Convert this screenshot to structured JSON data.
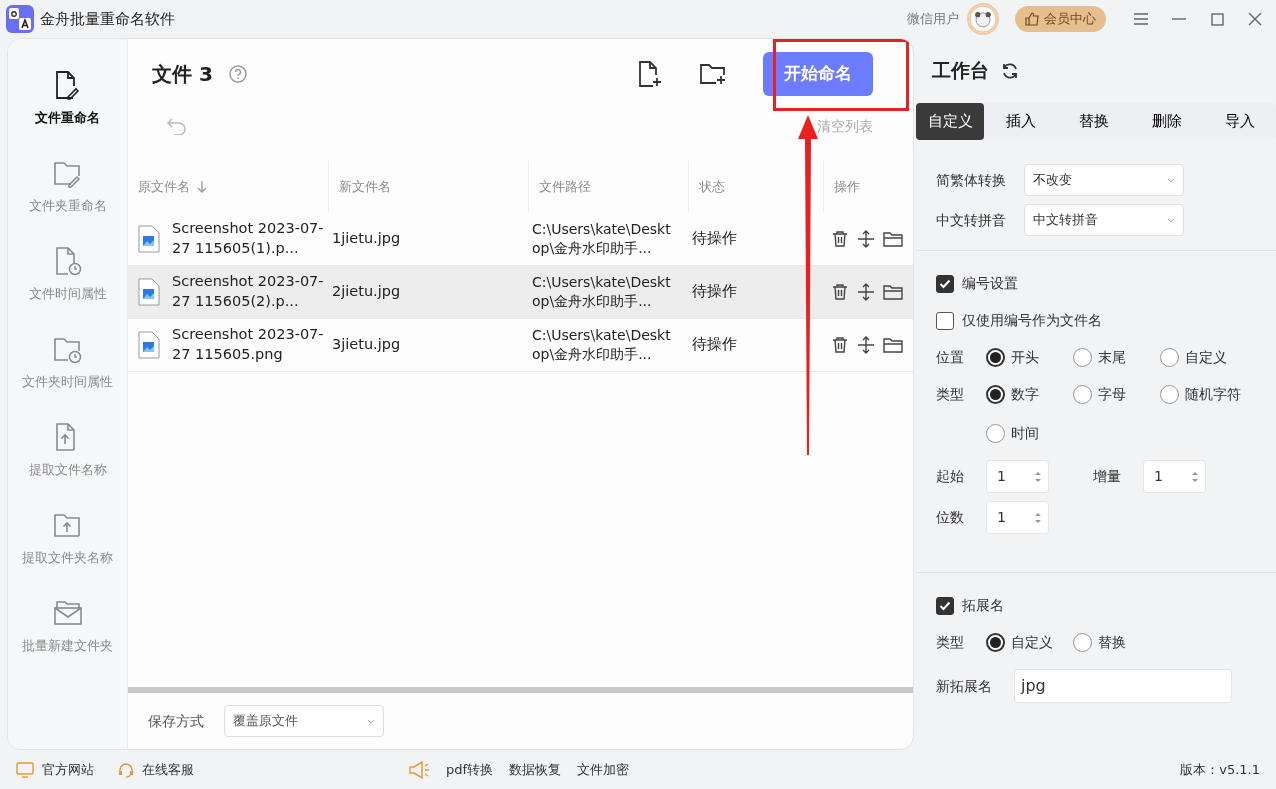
{
  "window": {
    "title": "金舟批量重命名软件",
    "user": "微信用户",
    "vip_button": "会员中心"
  },
  "sidebar": {
    "items": [
      {
        "label": "文件重命名",
        "selected": true
      },
      {
        "label": "文件夹重命名",
        "selected": false
      },
      {
        "label": "文件时间属性",
        "selected": false
      },
      {
        "label": "文件夹时间属性",
        "selected": false
      },
      {
        "label": "提取文件名称",
        "selected": false
      },
      {
        "label": "提取文件夹名称",
        "selected": false
      },
      {
        "label": "批量新建文件夹",
        "selected": false
      }
    ]
  },
  "file_panel": {
    "title": "文件",
    "count": "3",
    "start_button": "开始命名",
    "clear_link": "清空列表",
    "table": {
      "columns": [
        "原文件名",
        "新文件名",
        "文件路径",
        "状态",
        "操作"
      ],
      "rows": [
        {
          "original": "Screenshot 2023-07-27 115605(1).p...",
          "new": "1jietu.jpg",
          "path": "C:\\Users\\kate\\Desktop\\金舟水印助手...",
          "status": "待操作",
          "selected": false
        },
        {
          "original": "Screenshot 2023-07-27 115605(2).p...",
          "new": "2jietu.jpg",
          "path": "C:\\Users\\kate\\Desktop\\金舟水印助手...",
          "status": "待操作",
          "selected": true
        },
        {
          "original": "Screenshot 2023-07-27 115605.png",
          "new": "3jietu.jpg",
          "path": "C:\\Users\\kate\\Desktop\\金舟水印助手...",
          "status": "待操作",
          "selected": false
        }
      ]
    },
    "save_label": "保存方式",
    "save_value": "覆盖原文件"
  },
  "workbench": {
    "title": "工作台",
    "tabs": [
      {
        "label": "自定义",
        "selected": true
      },
      {
        "label": "插入",
        "selected": false
      },
      {
        "label": "替换",
        "selected": false
      },
      {
        "label": "删除",
        "selected": false
      },
      {
        "label": "导入",
        "selected": false
      }
    ],
    "selects": [
      {
        "label": "简繁体转换",
        "value": "不改变"
      },
      {
        "label": "中文转拼音",
        "value": "中文转拼音"
      }
    ],
    "numbering": {
      "label": "编号设置",
      "checked": true,
      "only_number": {
        "label": "仅使用编号作为文件名",
        "checked": false
      },
      "position": {
        "label": "位置",
        "options": [
          {
            "label": "开头",
            "selected": true
          },
          {
            "label": "末尾",
            "selected": false
          },
          {
            "label": "自定义",
            "selected": false
          }
        ]
      },
      "type": {
        "label": "类型",
        "options": [
          {
            "label": "数字",
            "selected": true
          },
          {
            "label": "字母",
            "selected": false
          },
          {
            "label": "随机字符",
            "selected": false
          },
          {
            "label": "时间",
            "selected": false
          }
        ]
      },
      "start": {
        "label": "起始",
        "value": "1"
      },
      "step": {
        "label": "增量",
        "value": "1"
      },
      "digits": {
        "label": "位数",
        "value": "1"
      }
    },
    "extension": {
      "label": "拓展名",
      "checked": true,
      "type": {
        "label": "类型",
        "options": [
          {
            "label": "自定义",
            "selected": true
          },
          {
            "label": "替换",
            "selected": false
          }
        ]
      },
      "new_label": "新拓展名",
      "new_value": "jpg"
    }
  },
  "status_bar": {
    "left": [
      "官方网站",
      "在线客服"
    ],
    "center": [
      "pdf转换",
      "数据恢复",
      "文件加密"
    ],
    "version": "版本：v5.1.1"
  }
}
